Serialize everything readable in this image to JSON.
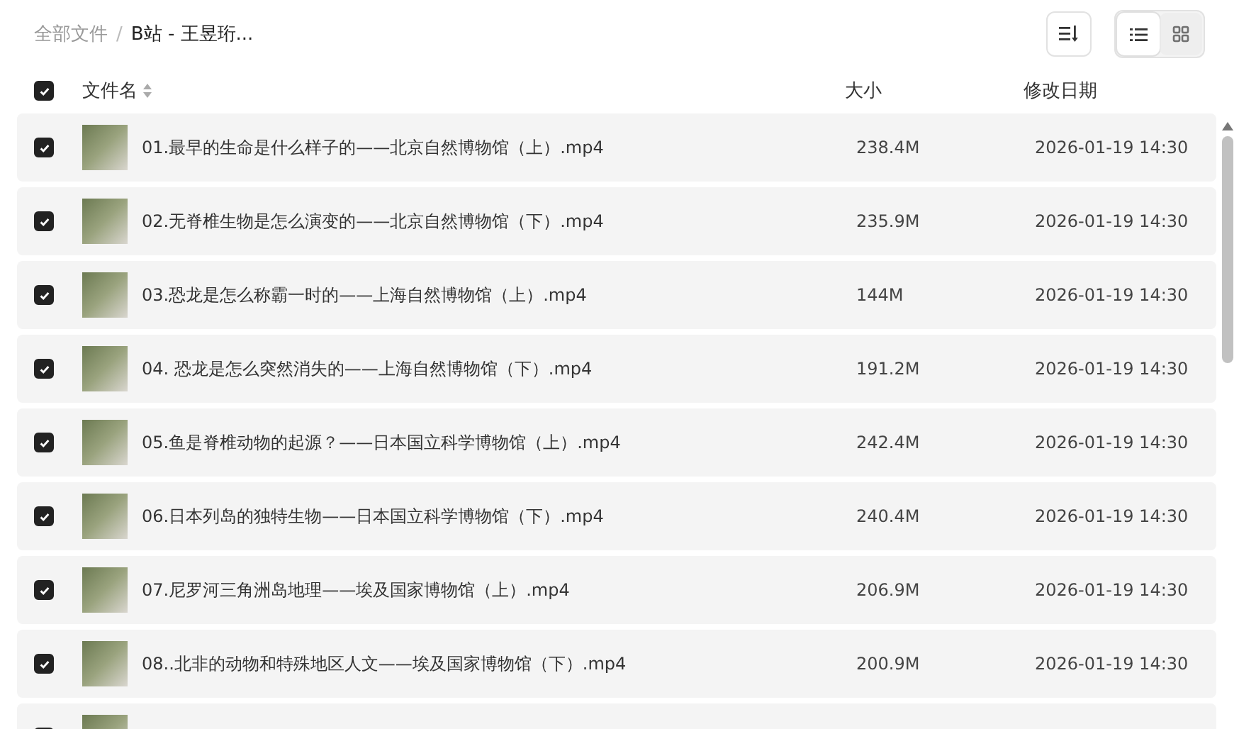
{
  "breadcrumb": [
    {
      "label": "全部文件",
      "current": false,
      "separator": "/"
    },
    {
      "label": "B站 - 王昱珩...",
      "current": true
    }
  ],
  "view_toggle": [
    {
      "kind": "list",
      "selected": true
    },
    {
      "kind": "grid",
      "selected": false
    }
  ],
  "header": {
    "checked": true,
    "columns": [
      "文件名",
      "大小",
      "修改日期"
    ]
  },
  "files": [
    {
      "checked": true,
      "name": "01.最早的生命是什么样子的——北京自然博物馆（上）.mp4",
      "size": "238.4M",
      "date": "2026-01-19 14:30"
    },
    {
      "checked": true,
      "name": "02.无脊椎生物是怎么演变的——北京自然博物馆（下）.mp4",
      "size": "235.9M",
      "date": "2026-01-19 14:30"
    },
    {
      "checked": true,
      "name": "03.恐龙是怎么称霸一时的——上海自然博物馆（上）.mp4",
      "size": "144M",
      "date": "2026-01-19 14:30"
    },
    {
      "checked": true,
      "name": "04. 恐龙是怎么突然消失的——上海自然博物馆（下）.mp4",
      "size": "191.2M",
      "date": "2026-01-19 14:30"
    },
    {
      "checked": true,
      "name": "05.鱼是脊椎动物的起源？——日本国立科学博物馆（上）.mp4",
      "size": "242.4M",
      "date": "2026-01-19 14:30"
    },
    {
      "checked": true,
      "name": "06.日本列岛的独特生物——日本国立科学博物馆（下）.mp4",
      "size": "240.4M",
      "date": "2026-01-19 14:30"
    },
    {
      "checked": true,
      "name": "07.尼罗河三角洲岛地理——埃及国家博物馆（上）.mp4",
      "size": "206.9M",
      "date": "2026-01-19 14:30"
    },
    {
      "checked": true,
      "name": "08..北非的动物和特殊地区人文——埃及国家博物馆（下）.mp4",
      "size": "200.9M",
      "date": "2026-01-19 14:30"
    },
    {
      "checked": true
    }
  ]
}
